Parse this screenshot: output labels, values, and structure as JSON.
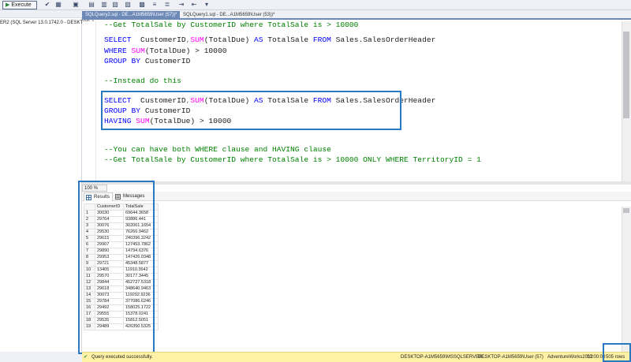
{
  "toolbar": {
    "execute_label": "Execute"
  },
  "explorer": {
    "server_label": "ER2 (SQL Server 13.0.1742.0 - DESKTOP-A"
  },
  "tabs": [
    {
      "label": "SQLQuery2.sql - DE...A1M5659\\User (57))*",
      "close": "✕"
    },
    {
      "label": "SQLQuery1.sql - DE...A1M5659\\User (53))*",
      "close": ""
    }
  ],
  "editor": {
    "line1": "--Get TotalSale by CustomerID where TotalSale is > 10000",
    "line2": {
      "kw1": "SELECT",
      "t1": "  CustomerID",
      "op1": ",",
      "fn1": "SUM",
      "t2": "(TotalDue) ",
      "kw2": "AS",
      "t3": " TotalSale ",
      "kw3": "FROM",
      "t4": " Sales.SalesOrderHeader"
    },
    "line3": {
      "kw1": "WHERE",
      "fn1": " SUM",
      "t1": "(TotalDue) > 10000"
    },
    "line4": {
      "kw1": "GROUP BY",
      "t1": " CustomerID"
    },
    "line5": "--Instead do this",
    "line6": {
      "kw1": "SELECT",
      "t1": "  CustomerID",
      "op1": ",",
      "fn1": "SUM",
      "t2": "(TotalDue) ",
      "kw2": "AS",
      "t3": " TotalSale ",
      "kw3": "FROM",
      "t4": " Sales.SalesOrderHeader"
    },
    "line7": {
      "kw1": "GROUP BY",
      "t1": " CustomerID"
    },
    "line8": {
      "kw1": "HAVING",
      "fn1": " SUM",
      "t1": "(TotalDue) > 10000"
    },
    "line9": "--You can have both WHERE clause and HAVING clause",
    "line10": "--Get TotalSale by CustomerID where TotalSale is > 10000 ONLY WHERE TerritoryID = 1"
  },
  "zoom": "100 %",
  "results_tabs": {
    "results": "Results",
    "messages": "Messages"
  },
  "grid": {
    "columns": [
      "CustomerID",
      "TotalSale"
    ],
    "rows": [
      [
        "1",
        "30030",
        "69644.3658"
      ],
      [
        "2",
        "29764",
        "93886.441"
      ],
      [
        "3",
        "30076",
        "302061.1654"
      ],
      [
        "4",
        "29530",
        "76266.9462"
      ],
      [
        "5",
        "29615",
        "240396.3242"
      ],
      [
        "6",
        "29907",
        "127453.7862"
      ],
      [
        "7",
        "29890",
        "14794.6376"
      ],
      [
        "8",
        "29953",
        "147426.0348"
      ],
      [
        "9",
        "29721",
        "45348.5877"
      ],
      [
        "10",
        "13405",
        "11910.3642"
      ],
      [
        "11",
        "29570",
        "30177.3445"
      ],
      [
        "12",
        "29844",
        "452727.5318"
      ],
      [
        "13",
        "29618",
        "348640.9463"
      ],
      [
        "14",
        "30073",
        "119292.9236"
      ],
      [
        "15",
        "29784",
        "377086.6246"
      ],
      [
        "16",
        "29492",
        "158025.1722"
      ],
      [
        "17",
        "29555",
        "15378.0241"
      ],
      [
        "18",
        "29535",
        "15812.5051"
      ],
      [
        "19",
        "29489",
        "426350.5325"
      ]
    ]
  },
  "status": {
    "message": "Query executed successfully.",
    "server": "DESKTOP-A1M5659\\MSSQLSERVER...",
    "user": "DESKTOP-A1M5659\\User (57)",
    "database": "AdventureWorks2012",
    "time": "00:00:00",
    "rows": "505 rows"
  },
  "colors": {
    "accent": "#2a78c0",
    "keyword": "#0000ff",
    "comment": "#008000",
    "function": "#ff00ff",
    "status_bar": "#fff1a6"
  }
}
